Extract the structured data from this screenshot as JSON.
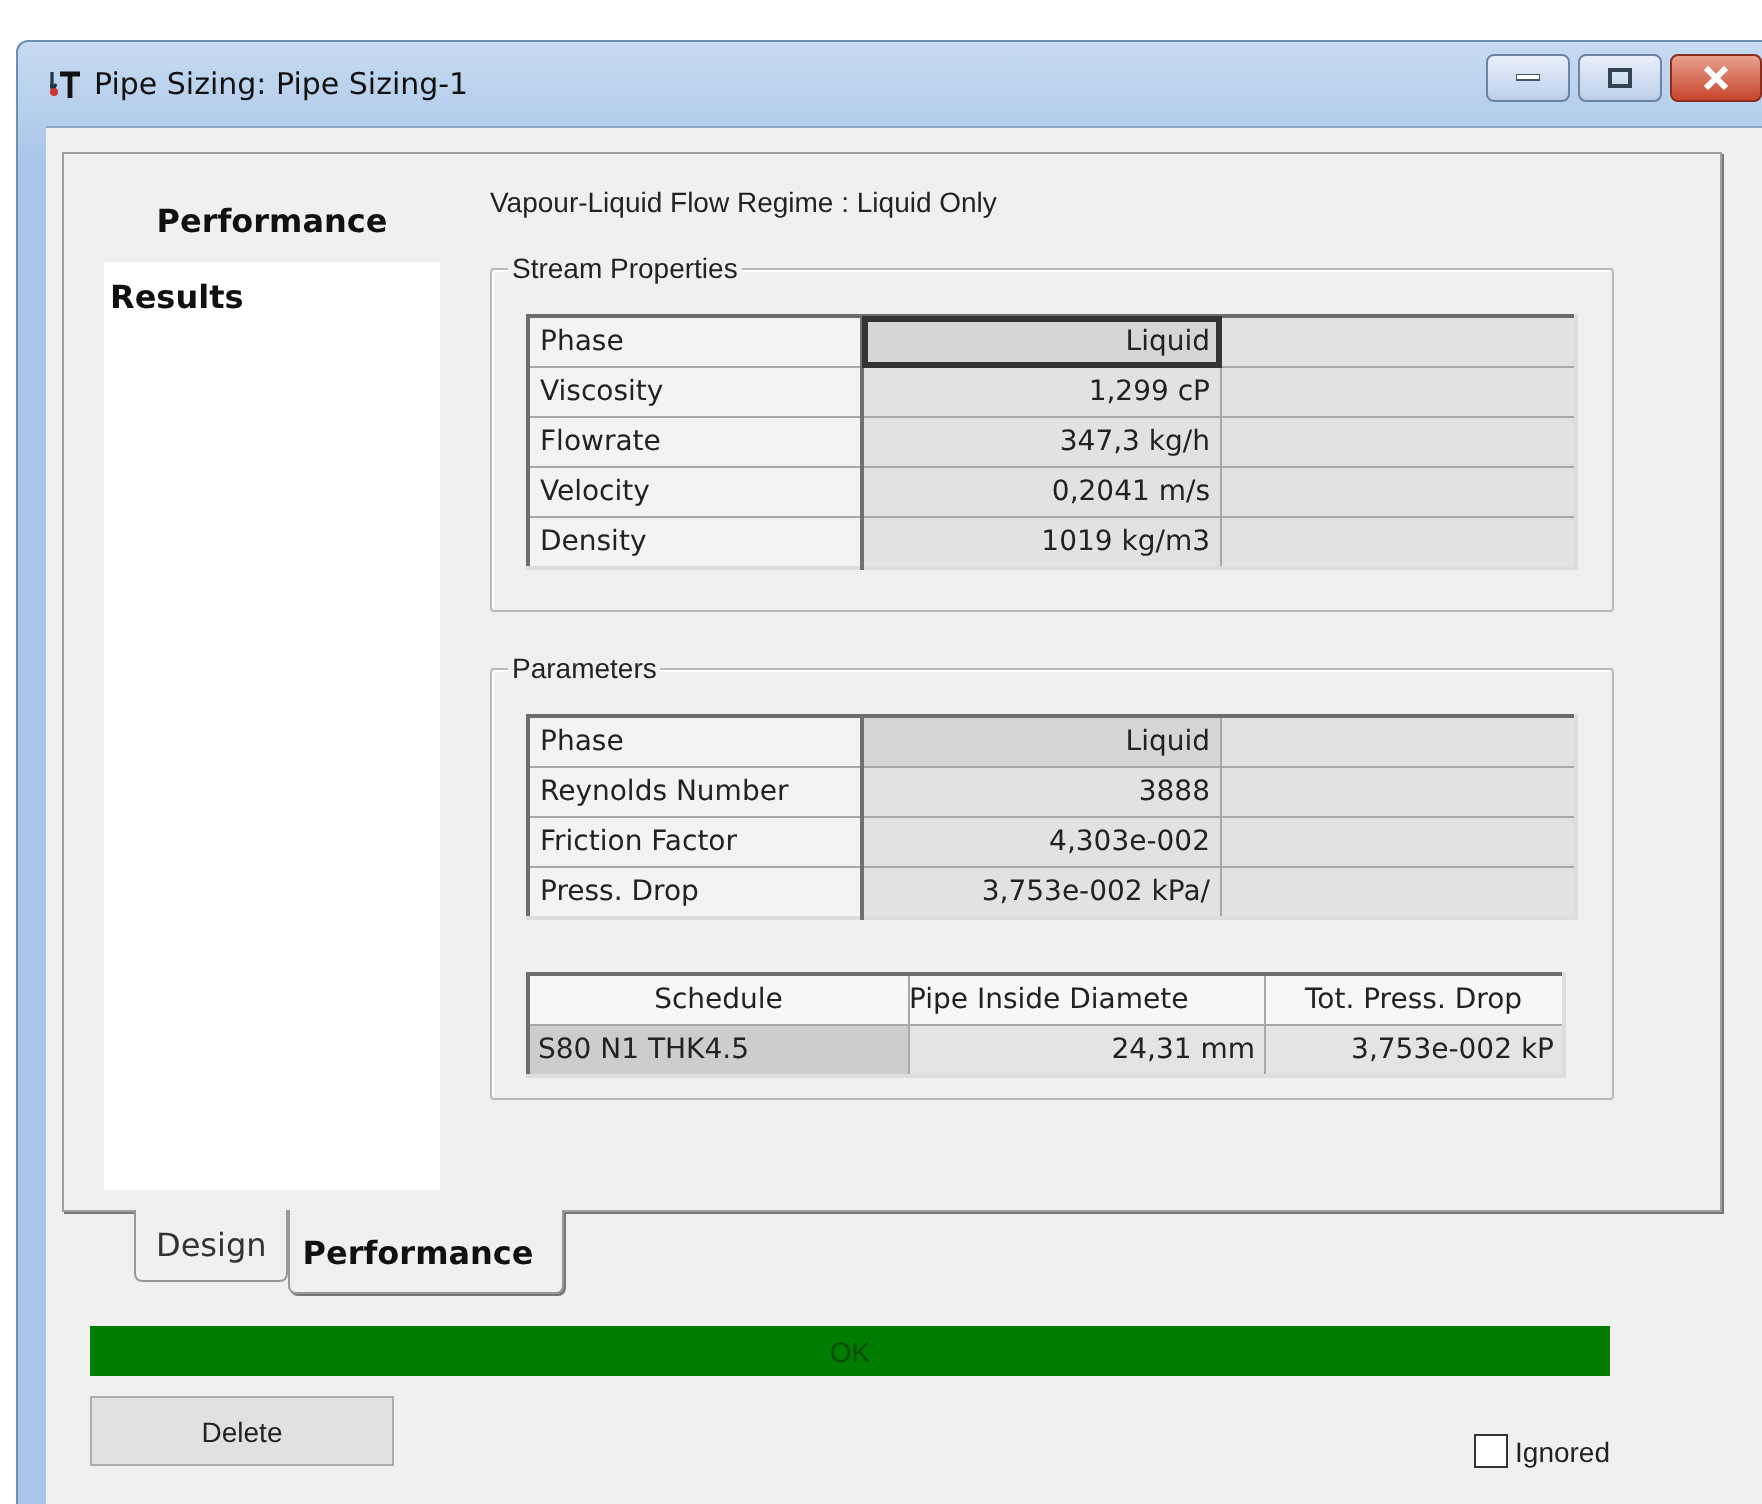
{
  "window": {
    "title": "Pipe Sizing: Pipe Sizing-1"
  },
  "sidebar": {
    "heading": "Performance",
    "items": [
      {
        "label": "Results",
        "selected": true
      }
    ]
  },
  "flow_regime": "Vapour-Liquid Flow Regime : Liquid Only",
  "stream_properties": {
    "title": "Stream Properties",
    "rows": [
      {
        "label": "Phase",
        "value": "Liquid",
        "focused": true
      },
      {
        "label": "Viscosity",
        "value": "1,299 cP",
        "focused": false
      },
      {
        "label": "Flowrate",
        "value": "347,3 kg/h",
        "focused": false
      },
      {
        "label": "Velocity",
        "value": "0,2041 m/s",
        "focused": false
      },
      {
        "label": "Density",
        "value": "1019 kg/m3",
        "focused": false
      }
    ]
  },
  "parameters": {
    "title": "Parameters",
    "rows": [
      {
        "label": "Phase",
        "value": "Liquid",
        "focused": false
      },
      {
        "label": "Reynolds Number",
        "value": "3888",
        "focused": false
      },
      {
        "label": "Friction Factor",
        "value": "4,303e-002",
        "focused": false
      },
      {
        "label": "Press. Drop",
        "value": "3,753e-002 kPa/",
        "focused": false
      }
    ],
    "schedule_table": {
      "columns": [
        "Schedule",
        "Pipe Inside Diamete",
        "Tot. Press. Drop"
      ],
      "rows": [
        {
          "cells": [
            "S80 N1 THK4.5",
            "24,31 mm",
            "3,753e-002 kP"
          ],
          "selected": true
        }
      ]
    }
  },
  "tabs": [
    {
      "label": "Design",
      "selected": false
    },
    {
      "label": "Performance",
      "selected": true
    }
  ],
  "status": "OK",
  "delete_button": "Delete",
  "ignored": {
    "label": "Ignored",
    "checked": false
  }
}
